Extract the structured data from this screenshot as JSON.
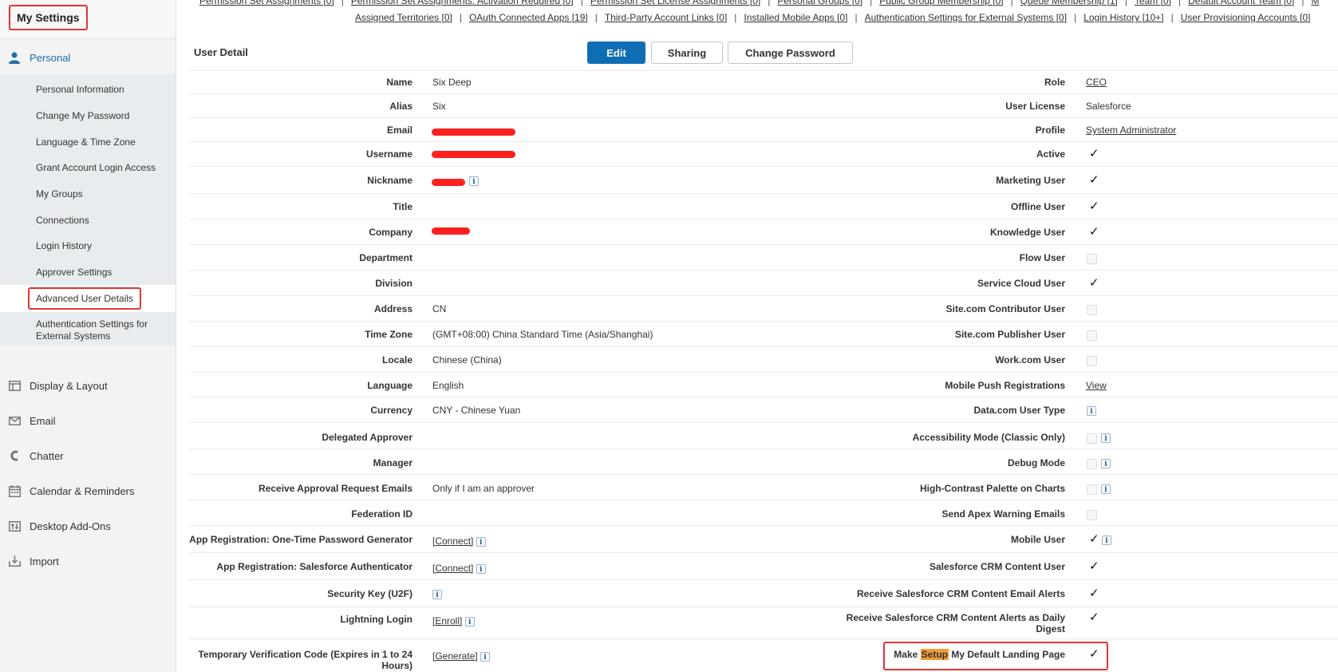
{
  "sidebar": {
    "title": "My Settings",
    "personal": {
      "label": "Personal",
      "items": [
        "Personal Information",
        "Change My Password",
        "Language & Time Zone",
        "Grant Account Login Access",
        "My Groups",
        "Connections",
        "Login History",
        "Approver Settings",
        "Advanced User Details",
        "Authentication Settings for",
        "External Systems"
      ]
    },
    "sections": [
      "Display & Layout",
      "Email",
      "Chatter",
      "Calendar & Reminders",
      "Desktop Add-Ons",
      "Import"
    ]
  },
  "toplinks": {
    "row1": [
      "Permission Set Assignments [0]",
      "Permission Set Assignments: Activation Required [0]",
      "Permission Set License Assignments [0]",
      "Personal Groups [0]",
      "Public Group Membership [0]",
      "Queue Membership [1]",
      "Team [0]",
      "Default Account Team [0]",
      "M"
    ],
    "row2": [
      "Assigned Territories [0]",
      "OAuth Connected Apps [19]",
      "Third-Party Account Links [0]",
      "Installed Mobile Apps [0]",
      "Authentication Settings for External Systems [0]",
      "Login History [10+]",
      "User Provisioning Accounts [0]"
    ],
    "sep": "|"
  },
  "detail": {
    "title": "User Detail",
    "buttons": {
      "edit": "Edit",
      "sharing": "Sharing",
      "change_password": "Change Password"
    },
    "left": [
      {
        "label": "Name",
        "value": "Six Deep"
      },
      {
        "label": "Alias",
        "value": "Six"
      },
      {
        "label": "Email",
        "value": ""
      },
      {
        "label": "Username",
        "value": ""
      },
      {
        "label": "Nickname",
        "value": ""
      },
      {
        "label": "Title",
        "value": ""
      },
      {
        "label": "Company",
        "value": ""
      },
      {
        "label": "Department",
        "value": ""
      },
      {
        "label": "Division",
        "value": ""
      },
      {
        "label": "Address",
        "value": "CN"
      },
      {
        "label": "Time Zone",
        "value": "(GMT+08:00) China Standard Time (Asia/Shanghai)"
      },
      {
        "label": "Locale",
        "value": "Chinese (China)"
      },
      {
        "label": "Language",
        "value": "English"
      },
      {
        "label": "Currency",
        "value": "CNY - Chinese Yuan"
      },
      {
        "label": "Delegated Approver",
        "value": ""
      },
      {
        "label": "Manager",
        "value": ""
      },
      {
        "label": "Receive Approval Request Emails",
        "value": "Only if I am an approver"
      },
      {
        "label": "Federation ID",
        "value": ""
      },
      {
        "label": "App Registration: One-Time Password Generator",
        "value": "[Connect]"
      },
      {
        "label": "App Registration: Salesforce Authenticator",
        "value": "[Connect]"
      },
      {
        "label": "Security Key (U2F)",
        "value": ""
      },
      {
        "label": "Lightning Login",
        "value": "[Enroll]"
      },
      {
        "label": "Temporary Verification Code (Expires in 1 to 24",
        "label2": "Hours)",
        "value": "[Generate]"
      }
    ],
    "right": [
      {
        "label": "Role",
        "value": "CEO"
      },
      {
        "label": "User License",
        "value": "Salesforce"
      },
      {
        "label": "Profile",
        "value": "System Administrator"
      },
      {
        "label": "Active",
        "checked": true
      },
      {
        "label": "Marketing User",
        "checked": true
      },
      {
        "label": "Offline User",
        "checked": true
      },
      {
        "label": "Knowledge User",
        "checked": true
      },
      {
        "label": "Flow User",
        "checked": false
      },
      {
        "label": "Service Cloud User",
        "checked": true
      },
      {
        "label": "Site.com Contributor User",
        "checked": false
      },
      {
        "label": "Site.com Publisher User",
        "checked": false
      },
      {
        "label": "Work.com User",
        "checked": false
      },
      {
        "label": "Mobile Push Registrations",
        "value": "View"
      },
      {
        "label": "Data.com User Type",
        "value": ""
      },
      {
        "label": "Accessibility Mode (Classic Only)",
        "checked": false
      },
      {
        "label": "Debug Mode",
        "checked": false
      },
      {
        "label": "High-Contrast Palette on Charts",
        "checked": false
      },
      {
        "label": "Send Apex Warning Emails",
        "checked": false
      },
      {
        "label": "Mobile User",
        "checked": true
      },
      {
        "label": "Salesforce CRM Content User",
        "checked": true
      },
      {
        "label": "Receive Salesforce CRM Content Email Alerts",
        "checked": true
      },
      {
        "label": "Receive Salesforce CRM Content Alerts as Daily",
        "label2": "Digest",
        "checked": true
      },
      {
        "label_pre": "Make ",
        "label_hl": "Setup",
        "label_post": " My Default Landing Page",
        "checked": true
      }
    ],
    "info_glyph": "i",
    "check_glyph": "✓"
  },
  "colors": {
    "accent": "#0f6db4",
    "highlight_box": "#e03434",
    "redaction": "#ff2020",
    "setup_highlight": "#f29c38"
  },
  "icons": [
    "person-icon",
    "display-layout-icon",
    "email-icon",
    "chatter-icon",
    "calendar-icon",
    "desktop-addons-icon",
    "import-icon",
    "info-icon",
    "checkmark-icon"
  ]
}
